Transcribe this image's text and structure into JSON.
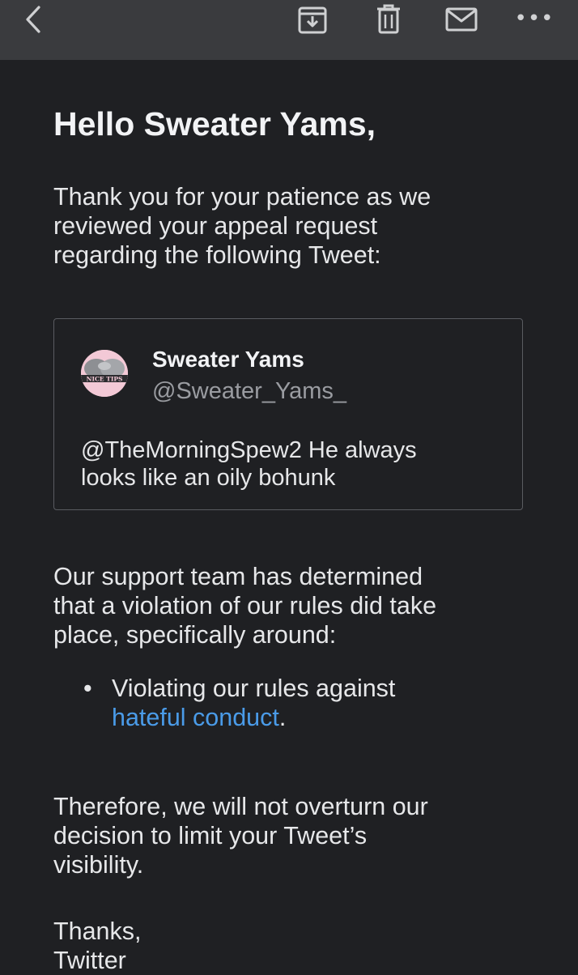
{
  "toolbar": {
    "back_icon": "chevron-left-icon",
    "archive_icon": "archive-icon",
    "trash_icon": "trash-icon",
    "mail_icon": "mail-icon",
    "more_icon": "more-horizontal-icon",
    "more_glyph": "•••"
  },
  "email": {
    "greeting": "Hello Sweater Yams,",
    "intro_lines": [
      "Thank you for your patience as we",
      "reviewed your appeal request",
      "regarding the following Tweet:"
    ],
    "tweet": {
      "name": "Sweater Yams",
      "handle": "@Sweater_Yams_",
      "avatar_text": "NICE TIPS",
      "text_lines": [
        "@TheMorningSpew2 He always",
        "looks like an oily bohunk"
      ]
    },
    "determination_lines": [
      "Our support team has determined",
      "that a violation of our rules did take",
      "place, specifically around:"
    ],
    "rule": {
      "bullet": "•",
      "line1": "Violating our rules against",
      "link_text": "hateful conduct",
      "suffix": "."
    },
    "decision_lines": [
      "Therefore, we will not overturn our",
      "decision to limit your Tweet’s",
      "visibility."
    ],
    "signoff_lines": [
      "Thanks,",
      "Twitter"
    ]
  },
  "colors": {
    "background": "#1f2023",
    "toolbar": "#3a3b3e",
    "text": "#e6e7e9",
    "muted": "#9a9ca1",
    "link": "#4a9be8",
    "card_border": "#5a5c61"
  }
}
